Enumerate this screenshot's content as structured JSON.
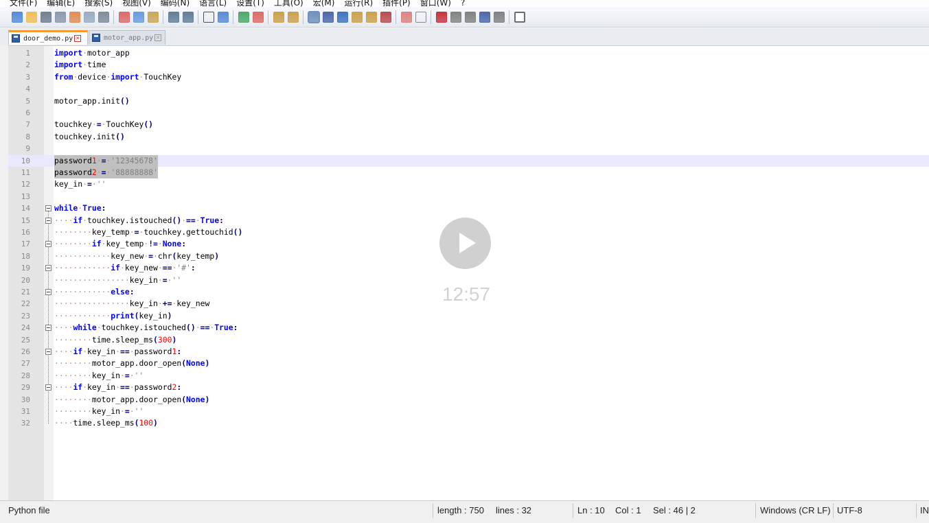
{
  "menu": {
    "items": [
      "文件(F)",
      "编辑(E)",
      "搜索(S)",
      "视图(V)",
      "编码(N)",
      "语言(L)",
      "设置(T)",
      "工具(O)",
      "宏(M)",
      "运行(R)",
      "插件(P)",
      "窗口(W)",
      "?"
    ]
  },
  "toolbar": {
    "icons": [
      "new-file-icon",
      "open-file-icon",
      "save-icon",
      "save-all-icon",
      "close-icon",
      "close-all-icon",
      "print-icon",
      "cut-icon",
      "copy-icon",
      "paste-icon",
      "undo-icon",
      "redo-icon",
      "find-icon",
      "replace-icon",
      "zoom-in-icon",
      "zoom-out-icon",
      "sync-vertical-icon",
      "sync-horizontal-icon",
      "word-wrap-icon",
      "show-all-chars-icon",
      "indent-guide-icon",
      "udl-icon",
      "doc-map-icon",
      "function-list-icon",
      "folder-workspace-icon",
      "monitoring-icon",
      "record-macro-icon",
      "stop-record-icon",
      "play-macro-icon",
      "run-macro-multiple-icon",
      "save-macro-icon",
      "spell-check-icon"
    ]
  },
  "tabs": [
    {
      "label": "door_demo.py",
      "active": true
    },
    {
      "label": "motor_app.py",
      "active": false
    }
  ],
  "editor": {
    "lines": [
      {
        "n": "1",
        "code": "import·motor_app"
      },
      {
        "n": "2",
        "code": "import·time"
      },
      {
        "n": "3",
        "code": "from·device·import·TouchKey"
      },
      {
        "n": "4",
        "code": ""
      },
      {
        "n": "5",
        "code": "motor_app.init()"
      },
      {
        "n": "6",
        "code": ""
      },
      {
        "n": "7",
        "code": "touchkey·=·TouchKey()"
      },
      {
        "n": "8",
        "code": "touchkey.init()"
      },
      {
        "n": "9",
        "code": ""
      },
      {
        "n": "10",
        "code": "password1·=·'12345678'"
      },
      {
        "n": "11",
        "code": "password2·=·'88888888'"
      },
      {
        "n": "12",
        "code": "key_in·=·''"
      },
      {
        "n": "13",
        "code": ""
      },
      {
        "n": "14",
        "code": "while·True:"
      },
      {
        "n": "15",
        "code": "····if·touchkey.istouched()·==·True:"
      },
      {
        "n": "16",
        "code": "········key_temp·=·touchkey.gettouchid()"
      },
      {
        "n": "17",
        "code": "········if·key_temp·!=·None:"
      },
      {
        "n": "18",
        "code": "············key_new·=·chr(key_temp)"
      },
      {
        "n": "19",
        "code": "············if·key_new·==·'#':"
      },
      {
        "n": "20",
        "code": "················key_in·=·''"
      },
      {
        "n": "21",
        "code": "············else:"
      },
      {
        "n": "22",
        "code": "················key_in·+=·key_new"
      },
      {
        "n": "23",
        "code": "············print(key_in)"
      },
      {
        "n": "24",
        "code": "····while·touchkey.istouched()·==·True:"
      },
      {
        "n": "25",
        "code": "········time.sleep_ms(300)"
      },
      {
        "n": "26",
        "code": "····if·key_in·==·password1:"
      },
      {
        "n": "27",
        "code": "········motor_app.door_open(None)"
      },
      {
        "n": "28",
        "code": "········key_in·=·''"
      },
      {
        "n": "29",
        "code": "····if·key_in·==·password2:"
      },
      {
        "n": "30",
        "code": "········motor_app.door_open(None)"
      },
      {
        "n": "31",
        "code": "········key_in·=·''"
      },
      {
        "n": "32",
        "code": "····time.sleep_ms(100)"
      }
    ],
    "keywords": [
      "import",
      "from",
      "while",
      "True",
      "if",
      "None",
      "else",
      "print"
    ]
  },
  "overlay": {
    "duration": "12:57"
  },
  "status": {
    "file_type": "Python file",
    "length": "length : 750",
    "lines": "lines : 32",
    "ln": "Ln : 10",
    "col": "Col : 1",
    "sel": "Sel : 46 | 2",
    "eol": "Windows (CR LF)",
    "encoding": "UTF-8",
    "mode": "IN"
  }
}
